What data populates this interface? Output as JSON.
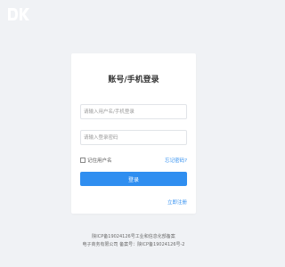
{
  "logo": {
    "icon": "dk-logo-icon"
  },
  "login": {
    "title": "账号/手机登录",
    "username_placeholder": "请输入用户名/手机登录",
    "password_placeholder": "请输入登录密码",
    "remember_label": "记住用户名",
    "forgot_label": "忘记密码?",
    "submit_label": "登录",
    "register_label": "立即注册"
  },
  "footer": {
    "line1": "陕ICP备19024126号工业和信息化部备案",
    "line2": "电子商务有限公司 备案号：陕ICP备19024126号-2"
  },
  "colors": {
    "accent": "#2f8ef0",
    "background": "#f0f2f5"
  }
}
